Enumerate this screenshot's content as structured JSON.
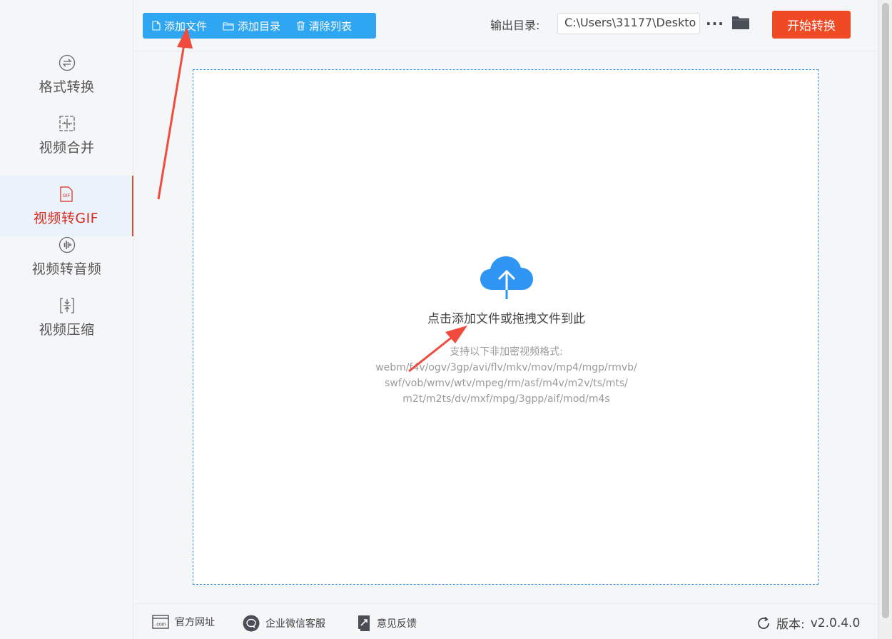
{
  "sidebar": {
    "items": [
      {
        "label": "格式转换",
        "icon": "format-convert-icon",
        "active": false
      },
      {
        "label": "视频合并",
        "icon": "video-merge-icon",
        "active": false
      },
      {
        "label": "视频转GIF",
        "icon": "gif-icon",
        "icon_text": "GIF",
        "active": true
      },
      {
        "label": "视频转音频",
        "icon": "audio-wave-icon",
        "active": false
      },
      {
        "label": "视频压缩",
        "icon": "compress-icon",
        "active": false
      }
    ]
  },
  "toolbar": {
    "add_file": "添加文件",
    "add_folder": "添加目录",
    "clear_list": "清除列表",
    "output_label": "输出目录:",
    "output_path": "C:\\Users\\31177\\Deskto",
    "more": "···",
    "start": "开始转换"
  },
  "dropzone": {
    "title": "点击添加文件或拖拽文件到此",
    "formats_heading": "支持以下非加密视频格式:",
    "formats_lines": [
      "webm/f4v/ogv/3gp/avi/flv/mkv/mov/mp4/mgp/rmvb/",
      "swf/vob/wmv/wtv/mpeg/rm/asf/m4v/m2v/ts/mts/",
      "m2t/m2ts/dv/mxf/mpg/3gpp/aif/mod/m4s"
    ]
  },
  "footer": {
    "website": "官方网址",
    "website_icon_text": ".com",
    "wechat": "企业微信客服",
    "feedback": "意见反馈",
    "version_label": "版本:",
    "version": "v2.0.4.0"
  },
  "colors": {
    "accent_blue": "#2ea6f2",
    "start_red": "#ef4a24",
    "active_red": "#d9291d",
    "annotation_red": "#f04b3c"
  }
}
